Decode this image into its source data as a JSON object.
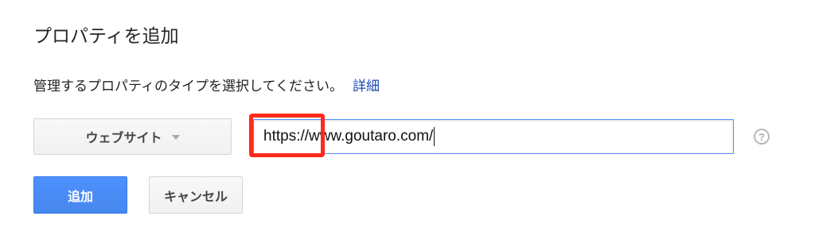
{
  "dialog": {
    "title": "プロパティを追加",
    "instruction": "管理するプロパティのタイプを選択してください。",
    "detail_link": "詳細"
  },
  "form": {
    "property_type": "ウェブサイト",
    "url_value": "https://www.goutaro.com/",
    "help_symbol": "?",
    "add_label": "追加",
    "cancel_label": "キャンセル"
  },
  "colors": {
    "primary_button": "#4d90fe",
    "link": "#1a4bb5",
    "highlight": "#ff2a1a",
    "input_focus_border": "#4d90fe"
  },
  "icons": [
    "chevron-down-icon",
    "help-icon"
  ]
}
